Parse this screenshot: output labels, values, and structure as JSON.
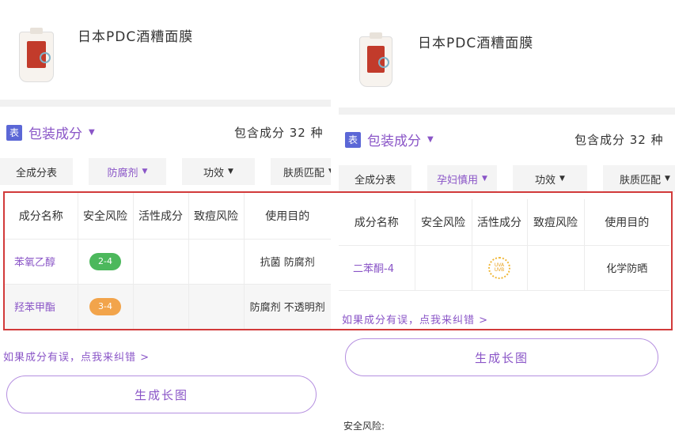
{
  "left": {
    "product_title": "日本PDC酒糟面膜",
    "section_title": "包装成分",
    "count_text": "包含成分 32 种",
    "filters": [
      {
        "label": "全成分表",
        "active": false,
        "caret": false
      },
      {
        "label": "防腐剂",
        "active": true,
        "caret": true
      },
      {
        "label": "功效",
        "active": false,
        "caret": true
      },
      {
        "label": "肤质匹配",
        "active": false,
        "caret": true
      }
    ],
    "table_headers": [
      "成分名称",
      "安全风险",
      "活性成分",
      "致痘风险",
      "使用目的"
    ],
    "rows": [
      {
        "name": "苯氧乙醇",
        "risk": "2-4",
        "risk_color": "#4cb85c",
        "purpose": "抗菌 防腐剂"
      },
      {
        "name": "羟苯甲酯",
        "risk": "3-4",
        "risk_color": "#f2a44b",
        "purpose": "防腐剂 不透明剂"
      }
    ],
    "report_link": "如果成分有误，点我来纠错 >",
    "generate_button": "生成长图"
  },
  "right": {
    "product_title": "日本PDC酒糟面膜",
    "section_title": "包装成分",
    "count_text": "包含成分 32 种",
    "filters": [
      {
        "label": "全成分表",
        "active": false,
        "caret": false
      },
      {
        "label": "孕妇慎用",
        "active": true,
        "caret": true
      },
      {
        "label": "功效",
        "active": false,
        "caret": true
      },
      {
        "label": "肤质匹配",
        "active": false,
        "caret": true
      }
    ],
    "table_headers": [
      "成分名称",
      "安全风险",
      "活性成分",
      "致痘风险",
      "使用目的"
    ],
    "rows": [
      {
        "name": "二苯酮-4",
        "active_icon_text": "UVA UVB",
        "purpose": "化学防晒"
      }
    ],
    "report_link": "如果成分有误，点我来纠错 >",
    "generate_button": "生成长图",
    "safety_label": "安全风险:"
  },
  "icons": {
    "section": "表",
    "caret": "▼"
  },
  "colors": {
    "accent": "#8a55c7",
    "highlight_box": "#d23a3a",
    "icon_blue": "#5b67d6"
  }
}
